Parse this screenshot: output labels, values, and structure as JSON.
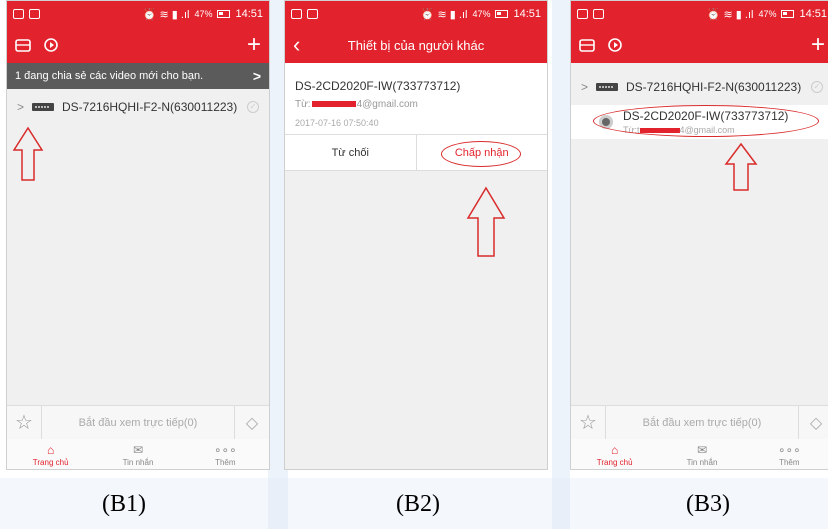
{
  "status_bar": {
    "battery": "47%",
    "time": "14:51"
  },
  "screens": {
    "b1": {
      "notice": "1 đang chia sẻ các video mới cho bạn.",
      "notice_arrow": ">",
      "device_name": "DS-7216HQHI-F2-N(630011223)",
      "bottom_live": "Bắt đầu xem trực tiếp(0)",
      "tabs": [
        "Trang chủ",
        "Tin nhắn",
        "Thêm"
      ],
      "caption": "(B1)"
    },
    "b2": {
      "title": "Thiết bị của người khác",
      "device_name": "DS-2CD2020F-IW(733773712)",
      "from_prefix": "Từ:",
      "from_suffix": "4@gmail.com",
      "date": "2017-07-16 07:50:40",
      "reject": "Từ chối",
      "accept": "Chấp nhận",
      "caption": "(B2)"
    },
    "b3": {
      "device_name": "DS-7216HQHI-F2-N(630011223)",
      "sub_device_name": "DS-2CD2020F-IW(733773712)",
      "sub_from_prefix": "Từ:t",
      "sub_from_suffix": "4@gmail.com",
      "bottom_live": "Bắt đầu xem trực tiếp(0)",
      "tabs": [
        "Trang chủ",
        "Tin nhắn",
        "Thêm"
      ],
      "caption": "(B3)"
    }
  },
  "colors": {
    "accent": "#e2222c",
    "annotation": "#d92b2b"
  },
  "icons": [
    "notification-icon",
    "gallery-icon",
    "playback-icon",
    "plus-icon",
    "back-icon",
    "star-icon",
    "eraser-icon",
    "home-icon",
    "message-icon",
    "more-icon",
    "dvr-icon",
    "camera-icon"
  ]
}
